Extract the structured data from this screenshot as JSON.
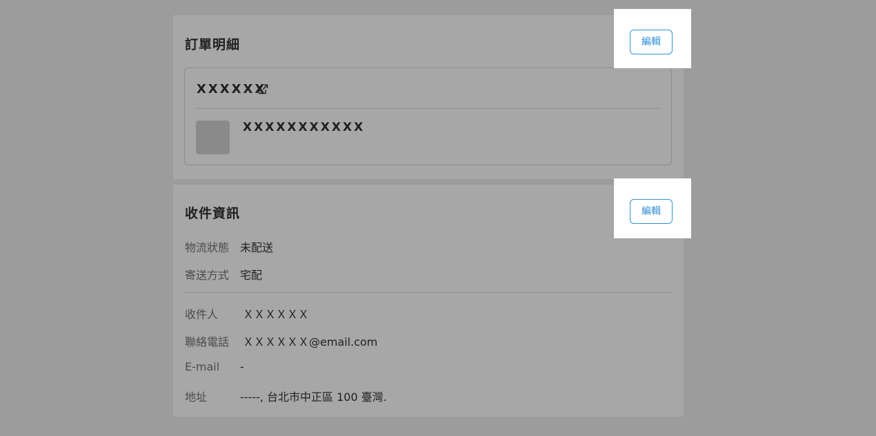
{
  "order_section": {
    "title": "訂單明細",
    "edit_label": "編輯",
    "shop_name": "XXXXXX",
    "item_name": "XXXXXXXXXXX"
  },
  "shipping_section": {
    "title": "收件資訊",
    "edit_label": "編輯",
    "logistics_status": {
      "label": "物流狀態",
      "value": "未配送"
    },
    "delivery_method": {
      "label": "寄送方式",
      "value": "宅配"
    },
    "recipient": {
      "label": "收件人",
      "value": "ＸＸＸＸＸＸ"
    },
    "phone": {
      "label": "聯絡電話",
      "value": "ＸＸＸＸＸＸ@email.com"
    },
    "email": {
      "label": "E-mail",
      "value": "-"
    },
    "address": {
      "label": "地址",
      "value": "-----, 台北市中正區 100 臺灣."
    }
  },
  "icons": {
    "external_link": "external-link-icon"
  },
  "colors": {
    "accent": "#2f90d8",
    "overlay": "#9c9c9c",
    "highlight": "#ffffff"
  }
}
